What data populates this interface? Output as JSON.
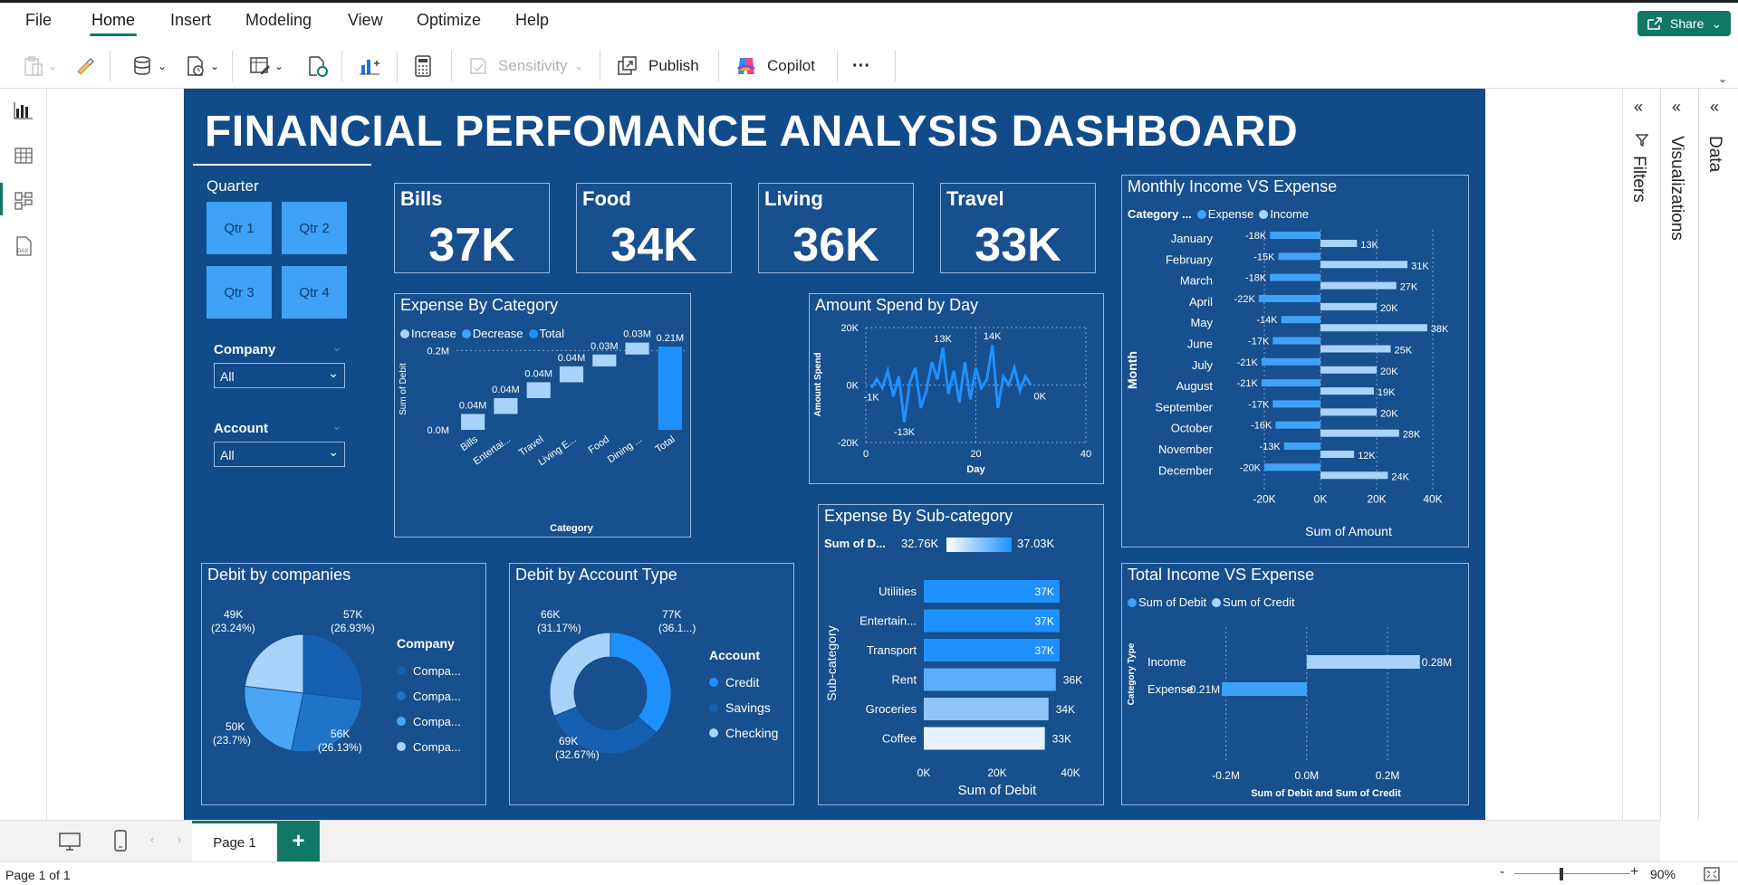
{
  "menu": {
    "file": "File",
    "home": "Home",
    "insert": "Insert",
    "modeling": "Modeling",
    "view": "View",
    "optimize": "Optimize",
    "help": "Help",
    "share": "Share"
  },
  "ribbon": {
    "sensitivity": "Sensitivity",
    "publish": "Publish",
    "copilot": "Copilot",
    "more": "···"
  },
  "panes": {
    "filters": "Filters",
    "visualizations": "Visualizations",
    "data": "Data"
  },
  "tabs": {
    "page1": "Page 1",
    "add": "+"
  },
  "status": {
    "page": "Page 1 of 1",
    "zoom": "90%"
  },
  "dashboard": {
    "title": "FINANCIAL PERFOMANCE ANALYSIS DASHBOARD",
    "kpis": [
      {
        "label": "Bills",
        "value": "37K"
      },
      {
        "label": "Food",
        "value": "34K"
      },
      {
        "label": "Living",
        "value": "36K"
      },
      {
        "label": "Travel",
        "value": "33K"
      }
    ],
    "slicers": {
      "quarter_title": "Quarter",
      "quarters": [
        "Qtr 1",
        "Qtr 2",
        "Qtr 3",
        "Qtr 4"
      ],
      "company_title": "Company",
      "company_value": "All",
      "account_title": "Account",
      "account_value": "All"
    },
    "colors": {
      "background": "#114b8a",
      "card": "#184f8e",
      "accent": "#3fa2f7",
      "light": "#a9d3fb",
      "mid": "#1f74c8"
    }
  },
  "chart_data": [
    {
      "id": "expense_by_category",
      "type": "waterfall",
      "title": "Expense By Category",
      "legend": [
        "Increase",
        "Decrease",
        "Total"
      ],
      "xlabel": "Category",
      "ylabel": "Sum of Debit",
      "yticks": [
        "0.0M",
        "0.2M"
      ],
      "ylim": [
        0,
        0.21
      ],
      "categories": [
        "Bills",
        "Entertai...",
        "Travel",
        "Living E...",
        "Food",
        "Dining ...",
        "Total"
      ],
      "values": [
        0.04,
        0.04,
        0.04,
        0.04,
        0.03,
        0.03,
        0.21
      ],
      "labels": [
        "0.04M",
        "0.04M",
        "0.04M",
        "0.04M",
        "0.03M",
        "0.03M",
        "0.21M"
      ]
    },
    {
      "id": "amount_spend_by_day",
      "type": "line",
      "title": "Amount Spend by Day",
      "xlabel": "Day",
      "ylabel": "Amount Spend",
      "xlim": [
        0,
        40
      ],
      "ylim": [
        -20,
        20
      ],
      "xticks": [
        "0",
        "20",
        "40"
      ],
      "yticks": [
        "20K",
        "0K",
        "-20K"
      ],
      "x": [
        1,
        2,
        3,
        4,
        5,
        6,
        7,
        8,
        9,
        10,
        11,
        12,
        13,
        14,
        15,
        16,
        17,
        18,
        19,
        20,
        21,
        22,
        23,
        24,
        25,
        26,
        27,
        28,
        29,
        30
      ],
      "y": [
        -1,
        2,
        -1,
        5,
        -4,
        3,
        -13,
        1,
        6,
        -8,
        -2,
        8,
        2,
        13,
        -3,
        5,
        -6,
        8,
        -5,
        6,
        -1,
        2,
        14,
        -8,
        3,
        0,
        6,
        -2,
        3,
        0
      ],
      "annotations": [
        {
          "text": "-1K",
          "x": 1,
          "y": -1
        },
        {
          "text": "-13K",
          "x": 7,
          "y": -13
        },
        {
          "text": "13K",
          "x": 14,
          "y": 13
        },
        {
          "text": "14K",
          "x": 23,
          "y": 14
        },
        {
          "text": "0K",
          "x": 30,
          "y": 0
        }
      ]
    },
    {
      "id": "monthly_income_vs_expense",
      "type": "bar",
      "orientation": "horizontal",
      "title": "Monthly Income VS Expense",
      "legend_title": "Category ...",
      "legend": [
        "Expense",
        "Income"
      ],
      "xlabel": "Sum of Amount",
      "ylabel": "Month",
      "xlim": [
        -20,
        40
      ],
      "xticks": [
        "-20K",
        "0K",
        "20K",
        "40K"
      ],
      "categories": [
        "January",
        "February",
        "March",
        "April",
        "May",
        "June",
        "July",
        "August",
        "September",
        "October",
        "November",
        "December"
      ],
      "series": [
        {
          "name": "Expense",
          "values": [
            -18,
            -15,
            -18,
            -22,
            -14,
            -17,
            -21,
            -21,
            -17,
            -16,
            -13,
            -20
          ],
          "labels": [
            "-18K",
            "-15K",
            "-18K",
            "-22K",
            "-14K",
            "-17K",
            "-21K",
            "-21K",
            "-17K",
            "-16K",
            "-13K",
            "-20K"
          ]
        },
        {
          "name": "Income",
          "values": [
            13,
            31,
            27,
            20,
            38,
            25,
            20,
            19,
            20,
            28,
            12,
            24
          ],
          "labels": [
            "13K",
            "31K",
            "27K",
            "20K",
            "38K",
            "25K",
            "20K",
            "19K",
            "20K",
            "28K",
            "12K",
            "24K"
          ]
        }
      ]
    },
    {
      "id": "expense_by_subcategory",
      "type": "bar",
      "orientation": "horizontal",
      "title": "Expense By Sub-category",
      "gradient_legend": {
        "label": "Sum of D...",
        "min": "32.76K",
        "max": "37.03K"
      },
      "xlabel": "Sum of Debit",
      "ylabel": "Sub-category",
      "xlim": [
        0,
        40
      ],
      "xticks": [
        "0K",
        "20K",
        "40K"
      ],
      "categories": [
        "Utilities",
        "Entertain...",
        "Transport",
        "Rent",
        "Groceries",
        "Coffee"
      ],
      "values": [
        37,
        37,
        37,
        36,
        34,
        33
      ],
      "labels": [
        "37K",
        "37K",
        "37K",
        "36K",
        "34K",
        "33K"
      ]
    },
    {
      "id": "debit_by_companies",
      "type": "pie",
      "title": "Debit by companies",
      "legend_title": "Company",
      "legend": [
        "Compa...",
        "Compa...",
        "Compa...",
        "Compa..."
      ],
      "values": [
        57,
        56,
        50,
        49
      ],
      "labels": [
        "57K\n(26.93%)",
        "56K\n(26.13%)",
        "50K\n(23.7%)",
        "49K\n(23.24%)"
      ]
    },
    {
      "id": "debit_by_account_type",
      "type": "donut",
      "title": "Debit by Account Type",
      "legend_title": "Account",
      "legend": [
        "Credit",
        "Savings",
        "Checking"
      ],
      "values": [
        77,
        69,
        66
      ],
      "labels": [
        "77K\n(36.1...)",
        "69K\n(32.67%)",
        "66K\n(31.17%)"
      ]
    },
    {
      "id": "total_income_vs_expense",
      "type": "bar",
      "orientation": "horizontal",
      "title": "Total Income VS Expense",
      "legend": [
        "Sum of Debit",
        "Sum of Credit"
      ],
      "xlabel": "Sum of Debit and Sum of Credit",
      "ylabel": "Category Type",
      "xlim": [
        -0.3,
        0.35
      ],
      "xticks": [
        "-0.2M",
        "0.0M",
        "0.2M"
      ],
      "categories": [
        "Income",
        "Expense"
      ],
      "values": [
        0.28,
        -0.21
      ],
      "labels": [
        "0.28M",
        "-0.21M"
      ]
    }
  ]
}
